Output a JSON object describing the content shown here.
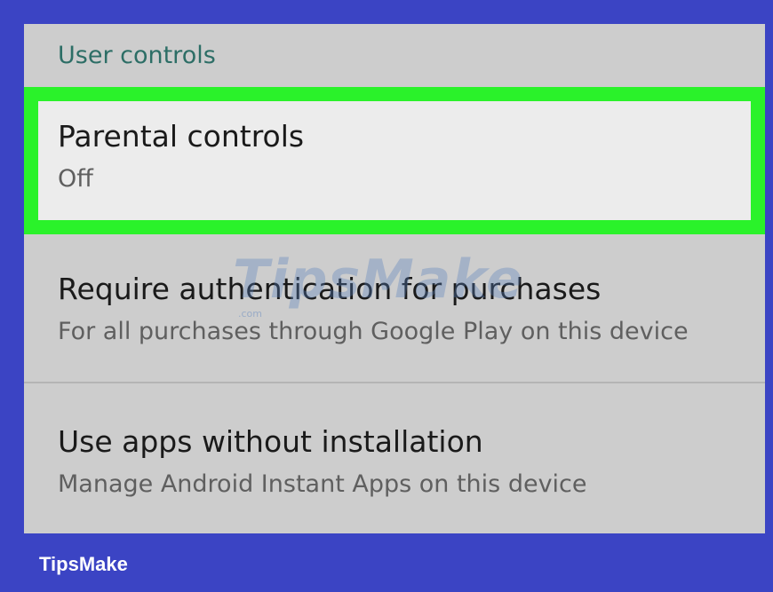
{
  "section": {
    "title": "User controls"
  },
  "items": [
    {
      "title": "Parental controls",
      "subtitle": "Off",
      "highlighted": true
    },
    {
      "title": "Require authentication for purchases",
      "subtitle": "For all purchases through Google Play on this device"
    },
    {
      "title": "Use apps without installation",
      "subtitle": "Manage Android Instant Apps on this device"
    }
  ],
  "watermark": {
    "text": "TipsMake",
    "sub": ".com"
  },
  "brand": {
    "label": "TipsMake"
  },
  "colors": {
    "frame": "#3b44c4",
    "panel": "#cdcdcd",
    "highlight": "#2af22a",
    "header_text": "#2d6e66"
  }
}
